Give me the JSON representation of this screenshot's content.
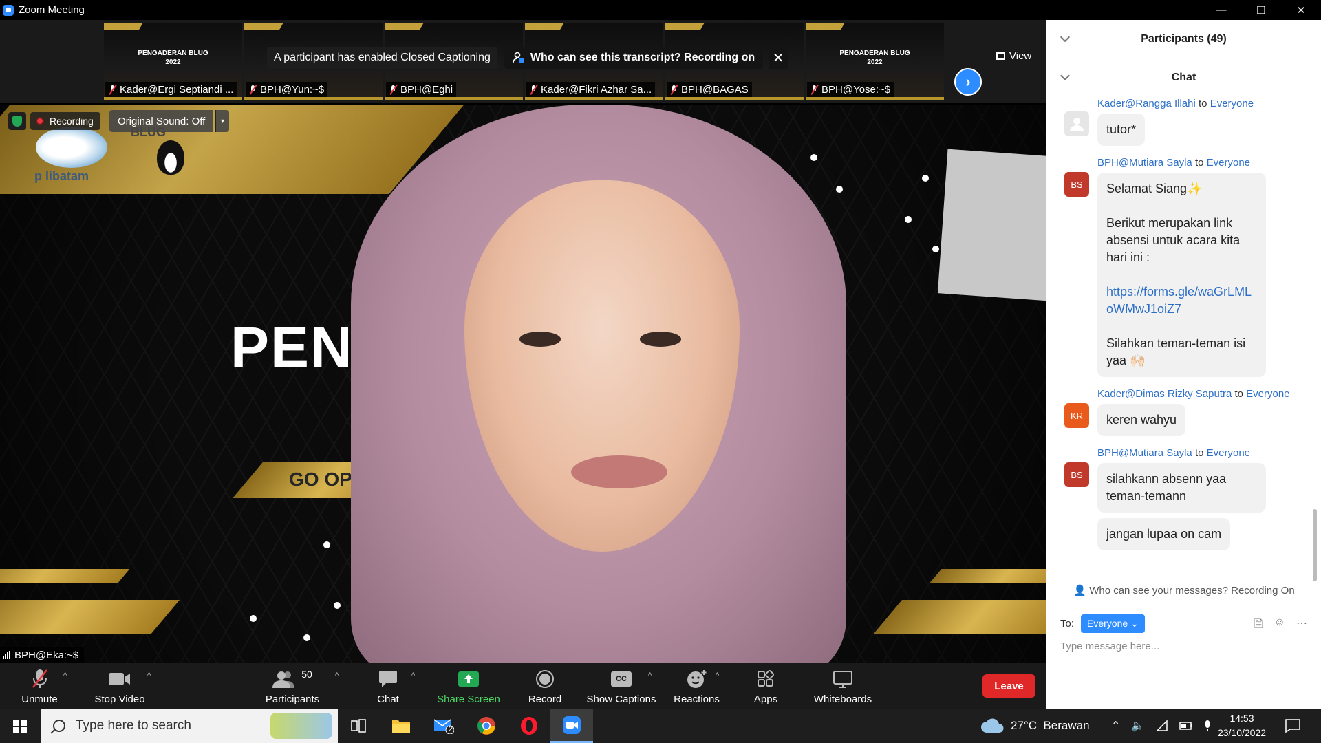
{
  "window": {
    "title": "Zoom Meeting",
    "controls": [
      "—",
      "❐",
      "✕"
    ]
  },
  "gallery": {
    "thumbnails": [
      {
        "name": "Kader@Ergi Septiandi ...",
        "slide_text": "PENGADERAN BLUG\n2022"
      },
      {
        "name": "BPH@Yun:~$",
        "slide_text": ""
      },
      {
        "name": "BPH@Eghi",
        "slide_text": ""
      },
      {
        "name": "Kader@Fikri Azhar Sa...",
        "slide_text": ""
      },
      {
        "name": "BPH@BAGAS",
        "slide_text": ""
      },
      {
        "name": "BPH@Yose:~$",
        "slide_text": "PENGADERAN BLUG\n2022"
      }
    ],
    "cc_notice": "A participant has enabled Closed Captioning",
    "transcript_notice": "Who can see this transcript? Recording on",
    "close_icon": "✕",
    "next_icon": "›",
    "view_label": "View"
  },
  "video": {
    "recording_label": "Recording",
    "original_sound": "Original Sound: Off",
    "caret": "▾",
    "active_speaker": "BPH@Eka:~$",
    "slide_title": "PENG          G",
    "slide_button": "GO OPE",
    "logo_text": "p  libatam",
    "logo_blug": "BLUG"
  },
  "toolbar": {
    "unmute": "Unmute",
    "stop_video": "Stop Video",
    "participants": "Participants",
    "participant_count": "50",
    "chat": "Chat",
    "share_screen": "Share Screen",
    "record": "Record",
    "show_captions": "Show Captions",
    "reactions": "Reactions",
    "apps": "Apps",
    "whiteboards": "Whiteboards",
    "leave": "Leave",
    "caret": "^",
    "cc_icon_text": "CC"
  },
  "panel": {
    "participants_header": "Participants (49)",
    "chat_header": "Chat",
    "messages": [
      {
        "sender": "Kader@Rangga Illahi",
        "avatar": "",
        "lines": [
          "tutor*"
        ]
      },
      {
        "sender": "BPH@Mutiara Sayla",
        "avatar": "BS",
        "paragraphs": [
          "Selamat Siang✨",
          "Berikut merupakan link absensi untuk acara kita hari ini :",
          "https://forms.gle/waGrLMLoWMwJ1oiZ7",
          "Silahkan teman-teman isi yaa 🙌🏻"
        ]
      },
      {
        "sender": "Kader@Dimas Rizky Saputra",
        "avatar": "KR",
        "lines": [
          "keren wahyu"
        ]
      },
      {
        "sender": "BPH@Mutiara Sayla",
        "avatar": "BS",
        "lines": [
          "silahkann absenn yaa teman-temann",
          "jangan lupaa on cam"
        ]
      }
    ],
    "to_word": "to",
    "to_everyone": "Everyone",
    "privacy_notice": "Who can see your messages? Recording On",
    "to_label": "To:",
    "recipient": "Everyone",
    "input_placeholder": "Type message here..."
  },
  "taskbar": {
    "search_placeholder": "Type here to search",
    "mail_badge": "2",
    "weather": "27°C  Berawan",
    "time": "14:53",
    "date": "23/10/2022"
  }
}
